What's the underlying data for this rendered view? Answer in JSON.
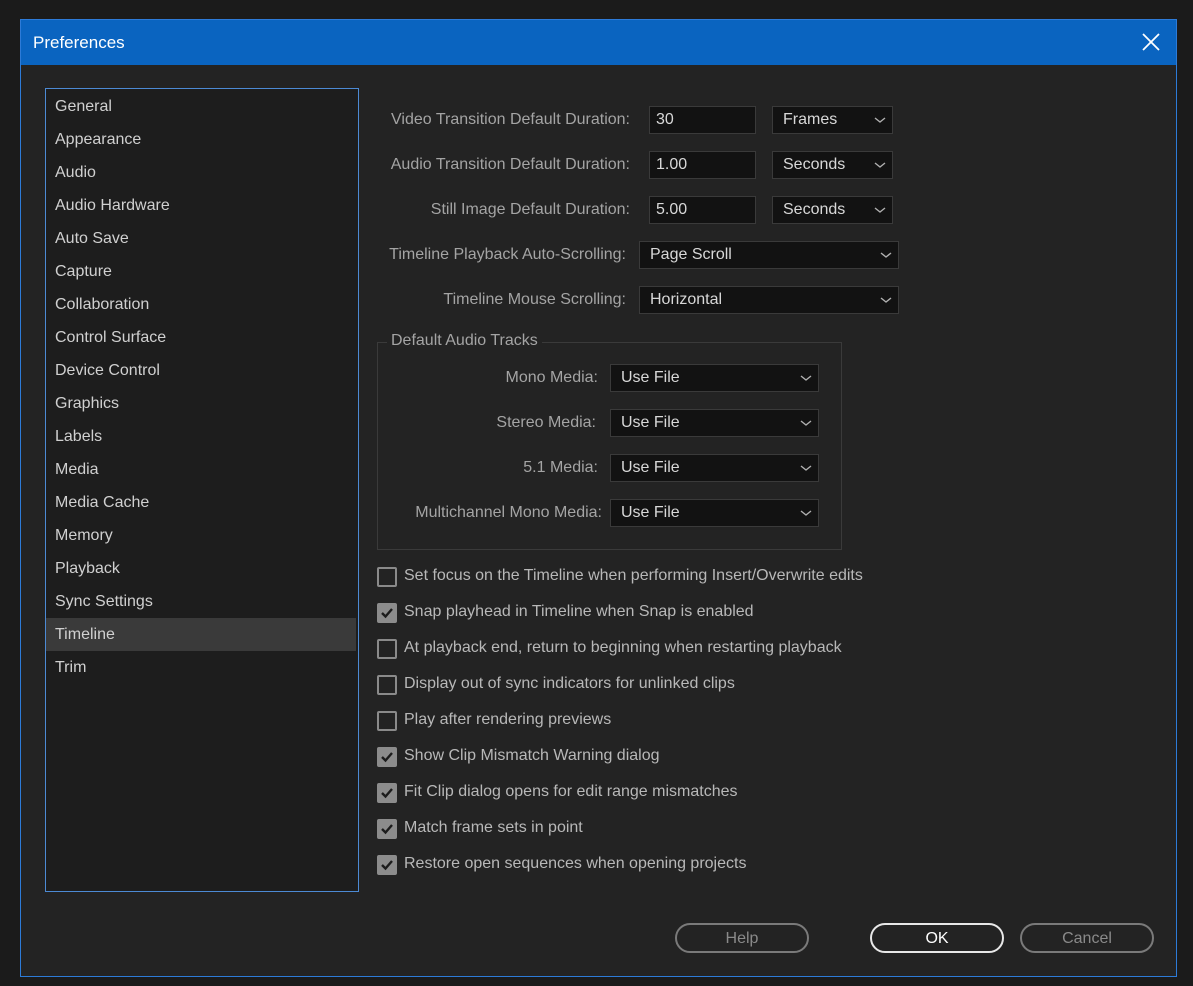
{
  "window": {
    "title": "Preferences"
  },
  "sidebar": {
    "items": [
      {
        "label": "General"
      },
      {
        "label": "Appearance"
      },
      {
        "label": "Audio"
      },
      {
        "label": "Audio Hardware"
      },
      {
        "label": "Auto Save"
      },
      {
        "label": "Capture"
      },
      {
        "label": "Collaboration"
      },
      {
        "label": "Control Surface"
      },
      {
        "label": "Device Control"
      },
      {
        "label": "Graphics"
      },
      {
        "label": "Labels"
      },
      {
        "label": "Media"
      },
      {
        "label": "Media Cache"
      },
      {
        "label": "Memory"
      },
      {
        "label": "Playback"
      },
      {
        "label": "Sync Settings"
      },
      {
        "label": "Timeline",
        "selected": true
      },
      {
        "label": "Trim"
      }
    ]
  },
  "fields": {
    "video_transition": {
      "label": "Video Transition Default Duration:",
      "value": "30",
      "unit": "Frames"
    },
    "audio_transition": {
      "label": "Audio Transition Default Duration:",
      "value": "1.00",
      "unit": "Seconds"
    },
    "still_image": {
      "label": "Still Image Default Duration:",
      "value": "5.00",
      "unit": "Seconds"
    },
    "auto_scrolling": {
      "label": "Timeline Playback Auto-Scrolling:",
      "value": "Page Scroll"
    },
    "mouse_scrolling": {
      "label": "Timeline Mouse Scrolling:",
      "value": "Horizontal"
    }
  },
  "audio_tracks": {
    "title": "Default Audio Tracks",
    "mono": {
      "label": "Mono Media:",
      "value": "Use File"
    },
    "stereo": {
      "label": "Stereo Media:",
      "value": "Use File"
    },
    "five_one": {
      "label": "5.1 Media:",
      "value": "Use File"
    },
    "multichannel": {
      "label": "Multichannel Mono Media:",
      "value": "Use File"
    }
  },
  "checkboxes": [
    {
      "label": "Set focus on the Timeline when performing Insert/Overwrite edits",
      "checked": false
    },
    {
      "label": "Snap playhead in Timeline when Snap is enabled",
      "checked": true
    },
    {
      "label": "At playback end, return to beginning when restarting playback",
      "checked": false
    },
    {
      "label": "Display out of sync indicators for unlinked clips",
      "checked": false
    },
    {
      "label": "Play after rendering previews",
      "checked": false
    },
    {
      "label": "Show Clip Mismatch Warning dialog",
      "checked": true
    },
    {
      "label": "Fit Clip dialog opens for edit range mismatches",
      "checked": true
    },
    {
      "label": "Match frame sets in point",
      "checked": true
    },
    {
      "label": "Restore open sequences when opening projects",
      "checked": true
    }
  ],
  "buttons": {
    "help": "Help",
    "ok": "OK",
    "cancel": "Cancel"
  },
  "icons": {
    "close": "close-icon",
    "dropdown": "chevron-down-icon",
    "check": "checkmark-icon"
  },
  "colors": {
    "titlebar": "#0a64c0",
    "accent_border": "#4c8ad4",
    "background": "#232323"
  }
}
